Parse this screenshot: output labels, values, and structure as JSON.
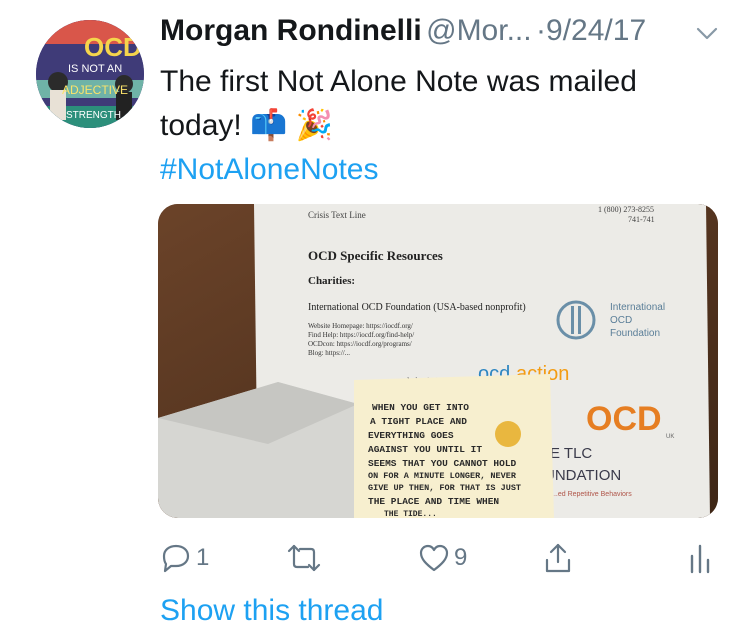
{
  "tweet": {
    "author_name": "Morgan Rondinelli",
    "handle": "@Mor...",
    "separator": "·",
    "date": "9/24/17",
    "text": "The first Not Alone Note was mailed today! 📫 🎉",
    "hashtag": "#NotAloneNotes",
    "show_thread": "Show this thread"
  },
  "avatar_art": {
    "line1": "OCD",
    "line2": "IS NOT AN",
    "line3": "ADJECTIVE",
    "line4": "STRENGTH"
  },
  "actions": {
    "reply_count": "1",
    "retweet_count": "",
    "like_count": "9"
  },
  "photo": {
    "doc_top_lines": "Crisis Text Line",
    "doc_phone": "1 (800) 273-8255",
    "doc_text_num": "741-741",
    "doc_heading": "OCD Specific Resources",
    "doc_subheading": "Charities:",
    "doc_iocdf": "International OCD Foundation (USA-based nonprofit)",
    "doc_links": [
      "Website Homepage: https://iocdf.org/",
      "Find Help: https://iocdf.org/find-help/",
      "OCDcon: https://iocdf.org/programs/",
      "Blog: https://..."
    ],
    "doc_charity": "...d charity)",
    "logo_iocdf": [
      "International",
      "OCD",
      "Foundation"
    ],
    "logo_ocdaction": [
      "ocd",
      "action"
    ],
    "logo_ocduk": "OCD",
    "logo_ocduk_sub": "UK",
    "logo_tlc": [
      "E TLC",
      "UNDATION"
    ],
    "logo_tlc_sub": "...ed Repetitive Behaviors",
    "note_text": [
      "WHEN YOU GET INTO",
      "A TIGHT PLACE AND",
      "EVERYTHING GOES",
      "AGAINST YOU UNTIL IT",
      "SEEMS THAT YOU CANNOT HOLD",
      "ON FOR A MINUTE LONGER, NEVER",
      "GIVE UP THEN, FOR THAT IS JUST",
      "THE PLACE AND TIME WHEN",
      "THE TIDE..."
    ]
  },
  "colors": {
    "link": "#1da1f2",
    "secondary": "#657786",
    "text": "#14171a"
  },
  "icons": [
    "reply-icon",
    "retweet-icon",
    "like-icon",
    "share-icon",
    "analytics-icon",
    "chevron-down-icon"
  ]
}
